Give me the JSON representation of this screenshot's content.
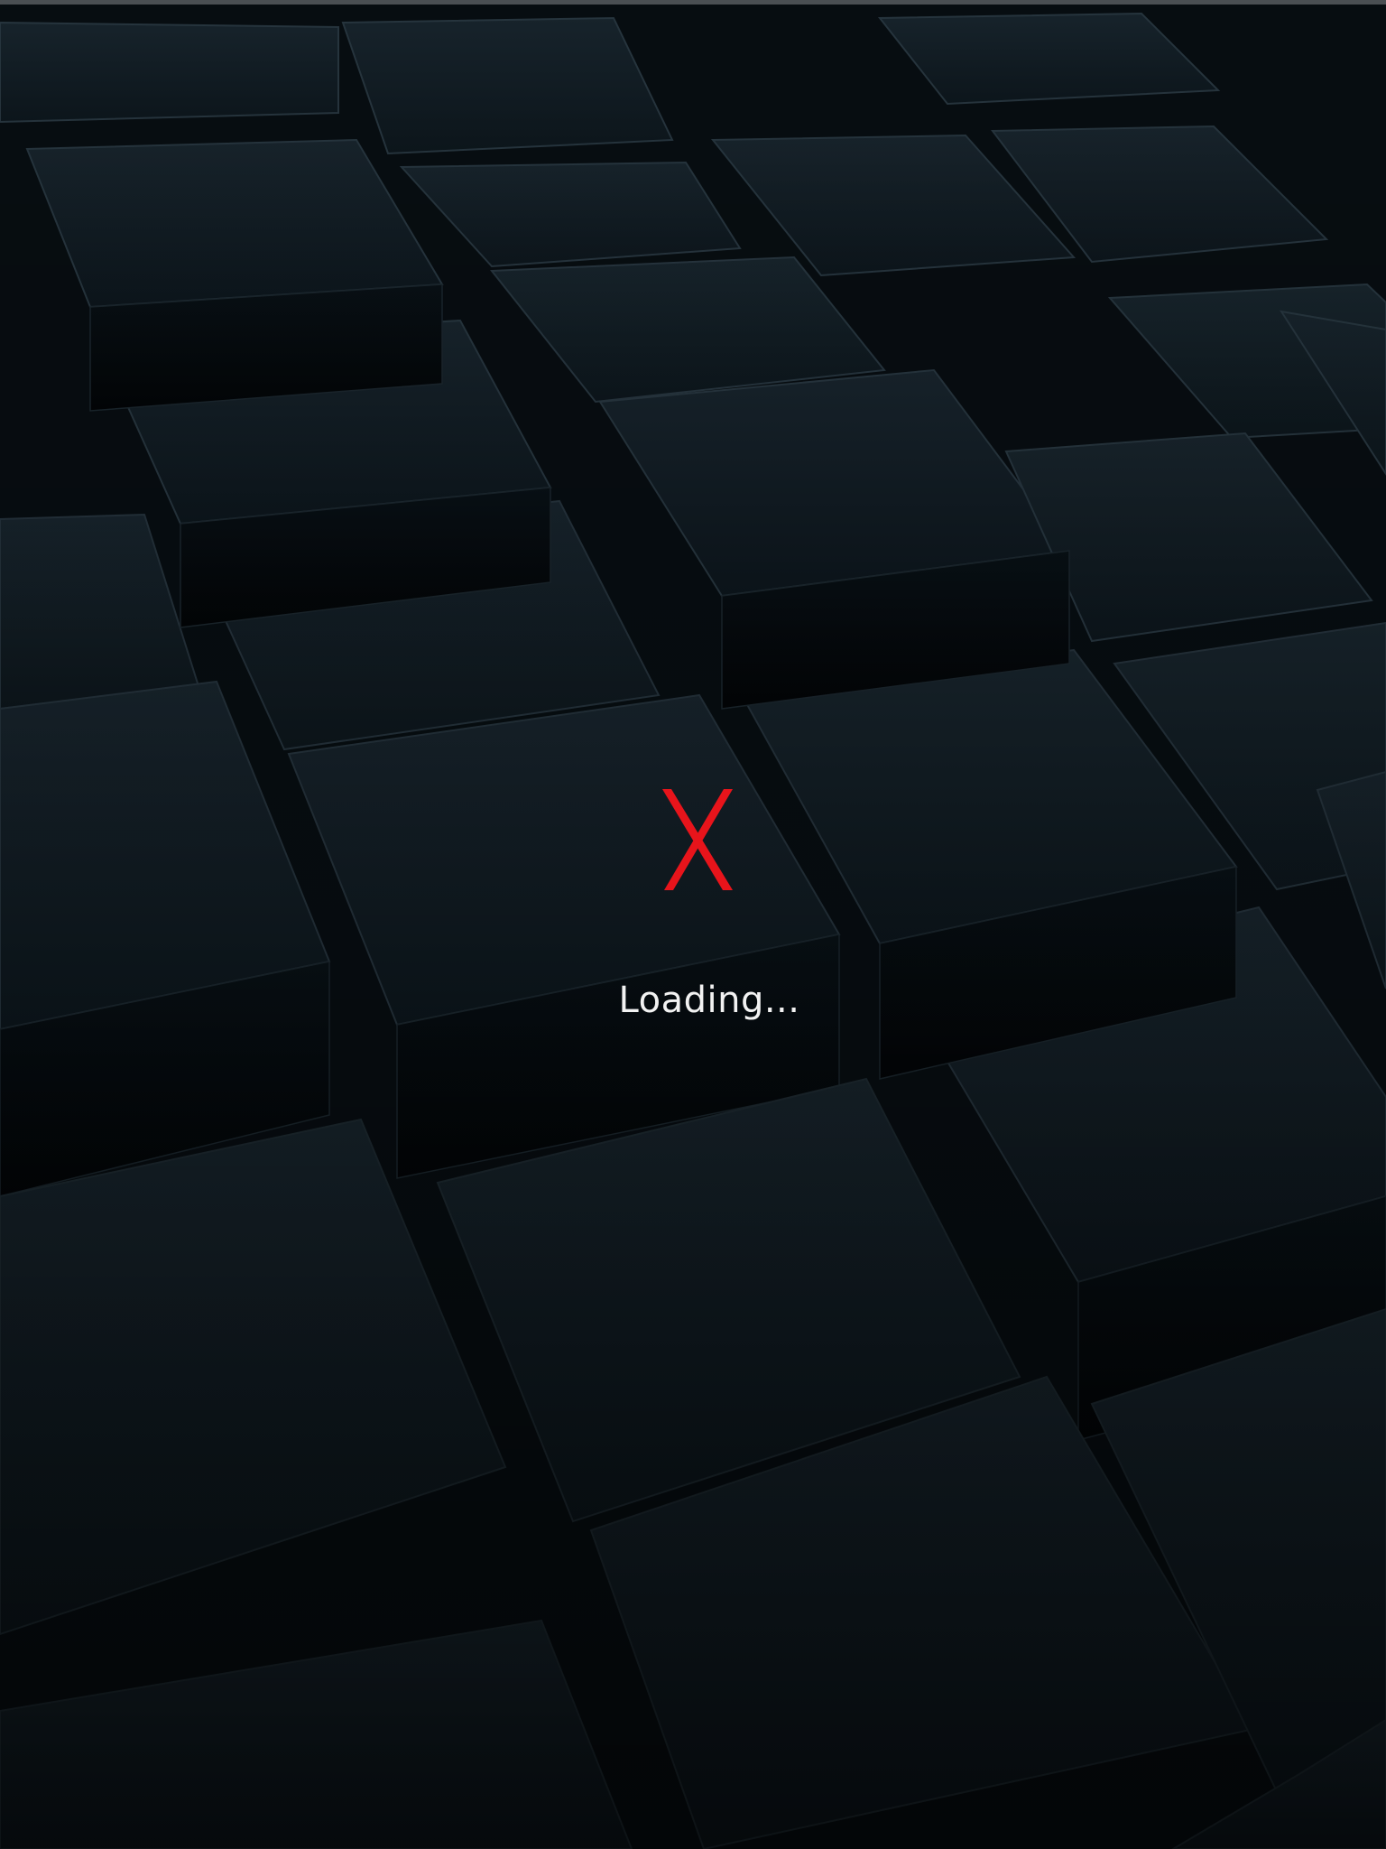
{
  "logo": {
    "icon": "x-logo-icon",
    "color": "#e8141b"
  },
  "status": {
    "loading_text": "Loading..."
  },
  "background": {
    "theme": "dark-3d-cubes",
    "top_color": "#0d161c",
    "bottom_color": "#04080b"
  }
}
